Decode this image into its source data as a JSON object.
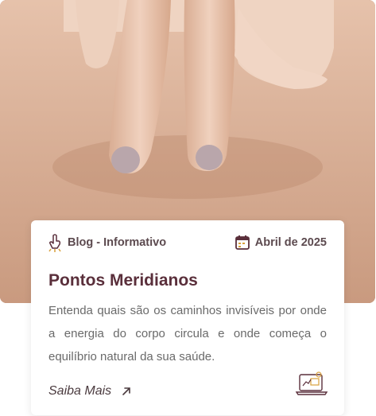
{
  "card": {
    "category": "Blog - Informativo",
    "date": "Abril de 2025",
    "title": "Pontos Meridianos",
    "description": "Entenda quais são os caminhos invisíveis por onde a energia do corpo circula e onde começa o equilíbrio natural da sua saúde.",
    "link_label": "Saiba Mais"
  },
  "colors": {
    "title": "#5a2f3b",
    "icon": "#5a2f3b",
    "accent_gold": "#d9a03c",
    "text": "#6a6a6a"
  },
  "icons": [
    "touch-icon",
    "calendar-icon",
    "arrow-up-right-icon",
    "laptop-chart-icon"
  ]
}
